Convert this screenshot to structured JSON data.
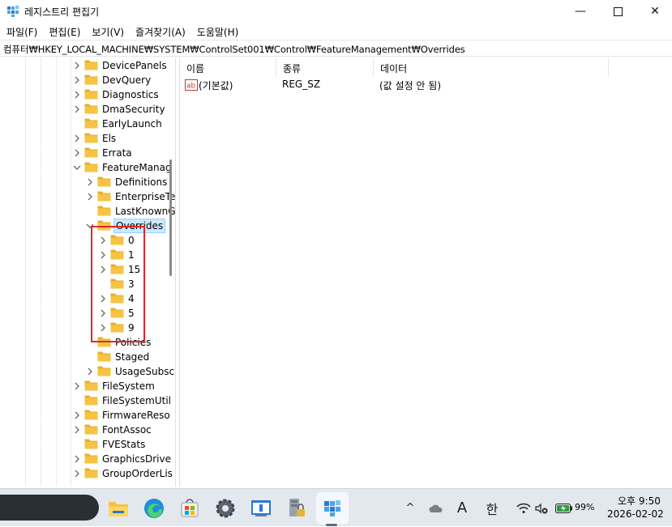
{
  "window": {
    "title": "레지스트리 편집기",
    "minimize_glyph": "—",
    "maximize_glyph": "☐",
    "close_glyph": "✕"
  },
  "menu": {
    "items": [
      "파일(F)",
      "편집(E)",
      "보기(V)",
      "즐겨찾기(A)",
      "도움말(H)"
    ]
  },
  "address": {
    "path": "컴퓨터₩HKEY_LOCAL_MACHINE₩SYSTEM₩ControlSet001₩Control₩FeatureManagement₩Overrides"
  },
  "tree": {
    "items": [
      {
        "label": "DevicePanels",
        "expander": "right",
        "selected": false
      },
      {
        "label": "DevQuery",
        "expander": "right",
        "selected": false
      },
      {
        "label": "Diagnostics",
        "expander": "right",
        "selected": false
      },
      {
        "label": "DmaSecurity",
        "expander": "right",
        "selected": false
      },
      {
        "label": "EarlyLaunch",
        "expander": "none",
        "selected": false
      },
      {
        "label": "Els",
        "expander": "right",
        "selected": false
      },
      {
        "label": "Errata",
        "expander": "right",
        "selected": false
      },
      {
        "label": "FeatureManag",
        "expander": "down",
        "selected": false
      },
      {
        "label": "Definitions",
        "expander": "right",
        "selected": false
      },
      {
        "label": "EnterpriseTe",
        "expander": "right",
        "selected": false
      },
      {
        "label": "LastKnownG",
        "expander": "none",
        "selected": false
      },
      {
        "label": "Overrides",
        "expander": "down",
        "selected": true
      },
      {
        "label": "0",
        "expander": "right",
        "selected": false
      },
      {
        "label": "1",
        "expander": "right",
        "selected": false
      },
      {
        "label": "15",
        "expander": "right",
        "selected": false
      },
      {
        "label": "3",
        "expander": "none",
        "selected": false
      },
      {
        "label": "4",
        "expander": "right",
        "selected": false
      },
      {
        "label": "5",
        "expander": "right",
        "selected": false
      },
      {
        "label": "9",
        "expander": "right",
        "selected": false
      },
      {
        "label": "Policies",
        "expander": "none",
        "selected": false
      },
      {
        "label": "Staged",
        "expander": "none",
        "selected": false
      },
      {
        "label": "UsageSubsc",
        "expander": "right",
        "selected": false
      },
      {
        "label": "FileSystem",
        "expander": "right",
        "selected": false
      },
      {
        "label": "FileSystemUtil",
        "expander": "none",
        "selected": false
      },
      {
        "label": "FirmwareReso",
        "expander": "right",
        "selected": false
      },
      {
        "label": "FontAssoc",
        "expander": "right",
        "selected": false
      },
      {
        "label": "FVEStats",
        "expander": "none",
        "selected": false
      },
      {
        "label": "GraphicsDrive",
        "expander": "right",
        "selected": false
      },
      {
        "label": "GroupOrderLis",
        "expander": "right",
        "selected": false
      }
    ]
  },
  "list": {
    "columns": [
      "이름",
      "종류",
      "데이터"
    ],
    "rows": [
      {
        "name": "(기본값)",
        "type": "REG_SZ",
        "data": "(값 설정 안 됨)",
        "icon": "string-value-icon"
      }
    ]
  },
  "taskbar": {
    "apps": [
      "file-explorer-icon",
      "edge-icon",
      "store-icon",
      "settings-icon",
      "control-panel-icon",
      "security-app-icon",
      "regedit-icon"
    ],
    "tray": {
      "chevron": "^",
      "ime_mode": "A",
      "ime_lang": "한",
      "battery": "99%"
    },
    "clock": {
      "time": "오후 9:50",
      "date": "2026-02-02"
    }
  },
  "colors": {
    "highlight_box": "#e0262a",
    "selection": "#cce8ff",
    "folder": "#f6c343",
    "taskbar": "#e3e8ef"
  }
}
